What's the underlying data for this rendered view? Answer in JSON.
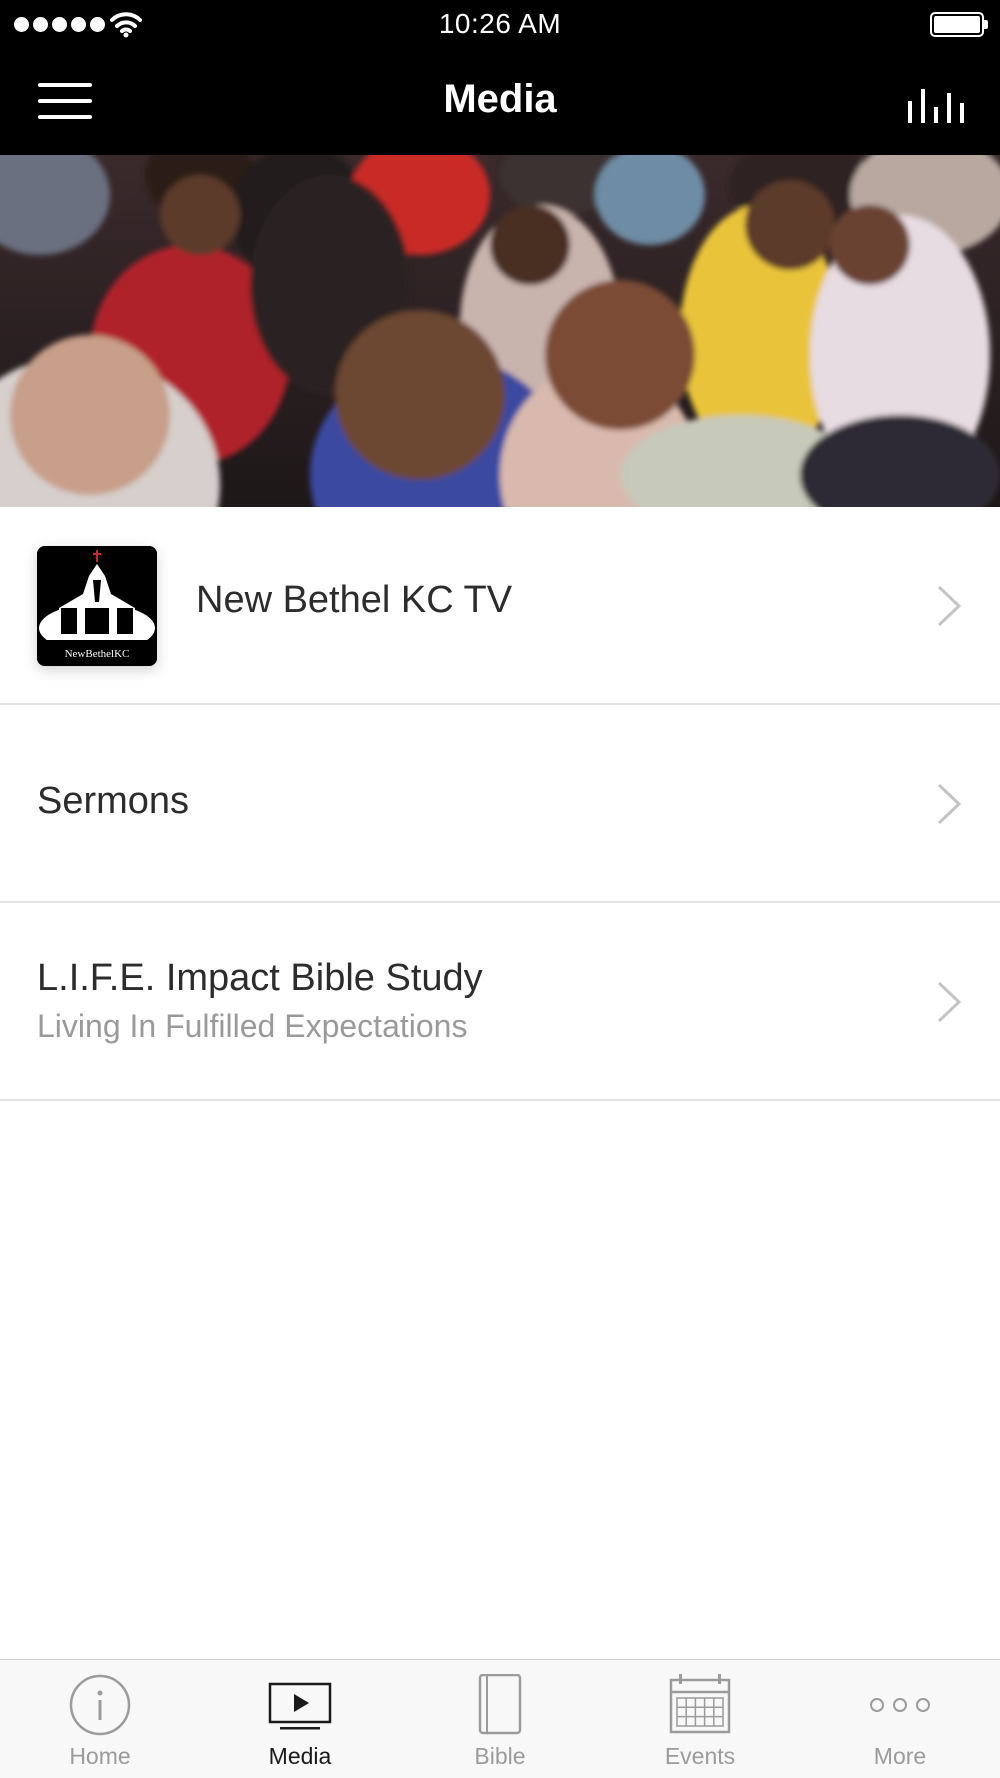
{
  "status_bar": {
    "time": "10:26 AM",
    "signal_icon": "signal-dots-icon",
    "wifi_icon": "wifi-icon",
    "battery_icon": "battery-icon",
    "battery_level": 1.0
  },
  "nav": {
    "title": "Media",
    "menu_icon": "hamburger-menu-icon",
    "audio_icon": "audio-bars-icon"
  },
  "hero": {
    "description_icon": "congregation-photo"
  },
  "list": {
    "items": [
      {
        "title": "New Bethel KC TV",
        "subtitle": "",
        "thumbnail_caption": "NewBethelKC"
      },
      {
        "title": "Sermons",
        "subtitle": ""
      },
      {
        "title": "L.I.F.E. Impact Bible Study",
        "subtitle": "Living In Fulfilled Expectations"
      }
    ]
  },
  "tabs": [
    {
      "label": "Home",
      "icon": "info-circle-icon",
      "active": false
    },
    {
      "label": "Media",
      "icon": "play-screen-icon",
      "active": true
    },
    {
      "label": "Bible",
      "icon": "book-icon",
      "active": false
    },
    {
      "label": "Events",
      "icon": "calendar-icon",
      "active": false
    },
    {
      "label": "More",
      "icon": "more-dots-icon",
      "active": false
    }
  ],
  "colors": {
    "bar_background": "#000000",
    "tab_active": "#1a1a1a",
    "tab_inactive": "#9b9b9b",
    "subtitle": "#9a9a9a",
    "divider": "#e2e2e2"
  }
}
